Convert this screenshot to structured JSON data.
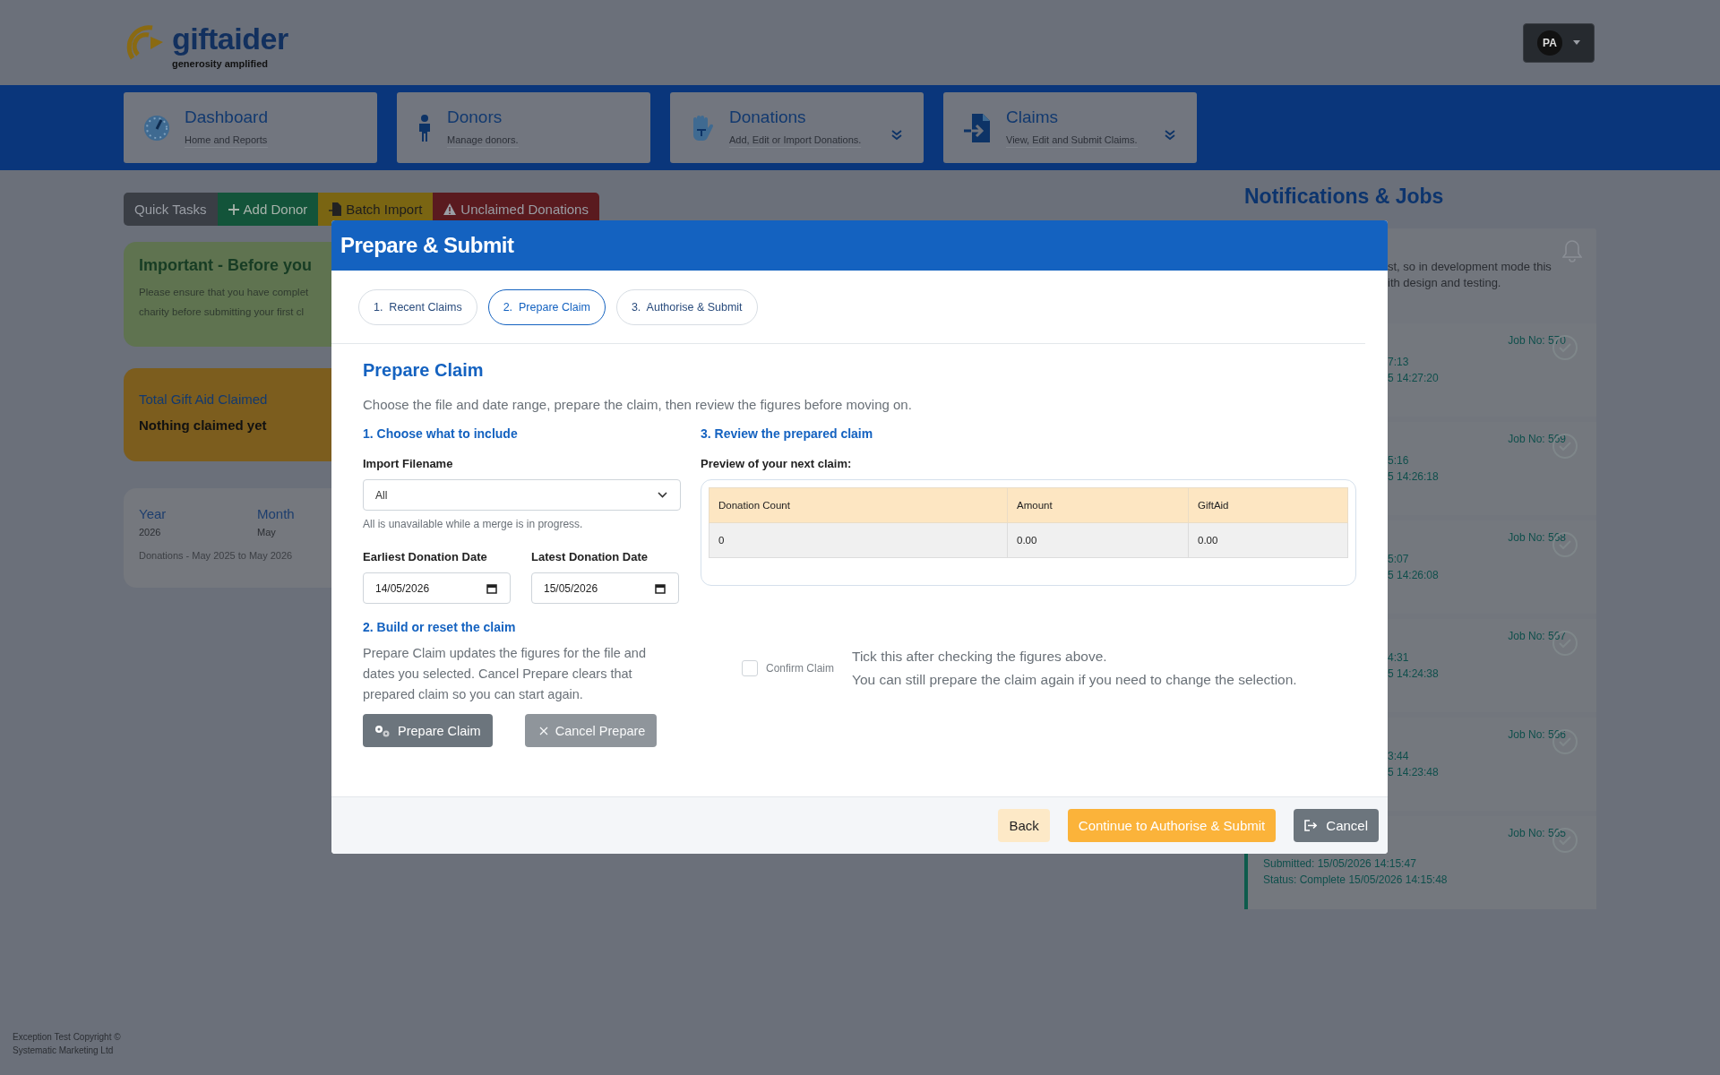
{
  "header": {
    "logo": {
      "name": "giftaider",
      "tagline": "generosity amplified"
    },
    "user": {
      "initials": "PA"
    }
  },
  "nav": [
    {
      "title": "Dashboard",
      "subtitle": "Home and Reports",
      "dropdown": false
    },
    {
      "title": "Donors",
      "subtitle": "Manage donors.",
      "dropdown": false
    },
    {
      "title": "Donations",
      "subtitle": "Add, Edit or Import Donations.",
      "dropdown": true
    },
    {
      "title": "Claims",
      "subtitle": "View, Edit and Submit Claims.",
      "dropdown": true
    }
  ],
  "quick_tasks": [
    {
      "label": "Quick Tasks",
      "kind": "title"
    },
    {
      "label": "Add Donor",
      "kind": "add"
    },
    {
      "label": "Batch Import",
      "kind": "import"
    },
    {
      "label": "Unclaimed Donations",
      "kind": "warning"
    }
  ],
  "important": {
    "title": "Important - Before you",
    "lines": [
      "Please ensure that you have complet",
      "charity before submitting your first cl"
    ]
  },
  "total": {
    "title": "Total Gift Aid Claimed",
    "value": "Nothing claimed yet"
  },
  "stats": {
    "items": [
      {
        "label": "Year",
        "value": "2026"
      },
      {
        "label": "Month",
        "value": "May"
      }
    ],
    "range": "Donations - May 2025 to May 2026"
  },
  "notifications": {
    "title": "Notifications & Jobs",
    "message_lines": [
      "st, so in development mode this",
      "ith design and testing."
    ],
    "jobs": [
      {
        "kind": "covered",
        "job_no": "Job No: 570",
        "lines": [
          "7:13",
          "5 14:27:20"
        ]
      },
      {
        "kind": "covered",
        "job_no": "Job No: 569",
        "lines": [
          "5:16",
          "5 14:26:18"
        ]
      },
      {
        "kind": "covered",
        "job_no": "Job No: 568",
        "lines": [
          "5:07",
          "5 14:26:08"
        ]
      },
      {
        "kind": "covered",
        "job_no": "Job No: 567",
        "lines": [
          "4:31",
          "5 14:24:38"
        ]
      },
      {
        "kind": "covered",
        "job_no": "Job No: 566",
        "lines": [
          "3:44",
          "5 14:23:48"
        ]
      },
      {
        "kind": "visible",
        "job_no": "Job No: 565",
        "lines": [
          "Submitted: 15/05/2026 14:15:47",
          "Status: Complete 15/05/2026 14:15:48"
        ]
      }
    ]
  },
  "footer": [
    "Exception Test Copyright ©",
    "Systematic Marketing Ltd"
  ],
  "modal": {
    "title": "Prepare & Submit",
    "steps": [
      {
        "label": "1.  Recent Claims",
        "selected": false
      },
      {
        "label": "2.  Prepare Claim",
        "selected": true
      },
      {
        "label": "3.  Authorise & Submit",
        "selected": false
      }
    ],
    "section_title": "Prepare Claim",
    "intro": "Choose the file and date range, prepare the claim, then review the figures before moving on.",
    "include": {
      "heading": "1. Choose what to include",
      "file_label": "Import Filename",
      "file_value": "All",
      "file_help": "All is unavailable while a merge is in progress.",
      "earliest_label": "Earliest Donation Date",
      "earliest_value": "14/05/2026",
      "latest_label": "Latest Donation Date",
      "latest_value": "15/05/2026"
    },
    "build": {
      "heading": "2. Build or reset the claim",
      "text": "Prepare Claim updates the figures for the file and dates you selected. Cancel Prepare clears that prepared claim so you can start again.",
      "prepare_button": {
        "label": "Prepare Claim",
        "disabled": false
      },
      "cancel_button": {
        "label": "Cancel Prepare",
        "disabled": true
      }
    },
    "review": {
      "heading": "3. Review the prepared claim",
      "preview_label": "Preview of your next claim:",
      "table": {
        "columns": [
          "Donation Count",
          "Amount",
          "GiftAid"
        ],
        "rows": [
          [
            "0",
            "0.00",
            "0.00"
          ]
        ]
      }
    },
    "confirm": {
      "label": "Confirm Claim",
      "checked": false,
      "notes": [
        "Tick this after checking the figures above.",
        "You can still prepare the claim again if you need to change the selection."
      ]
    },
    "footer_buttons": [
      {
        "label": "Back",
        "kind": "back"
      },
      {
        "label": "Continue to Authorise & Submit",
        "kind": "primary"
      },
      {
        "label": "Cancel",
        "kind": "cancel"
      }
    ]
  }
}
